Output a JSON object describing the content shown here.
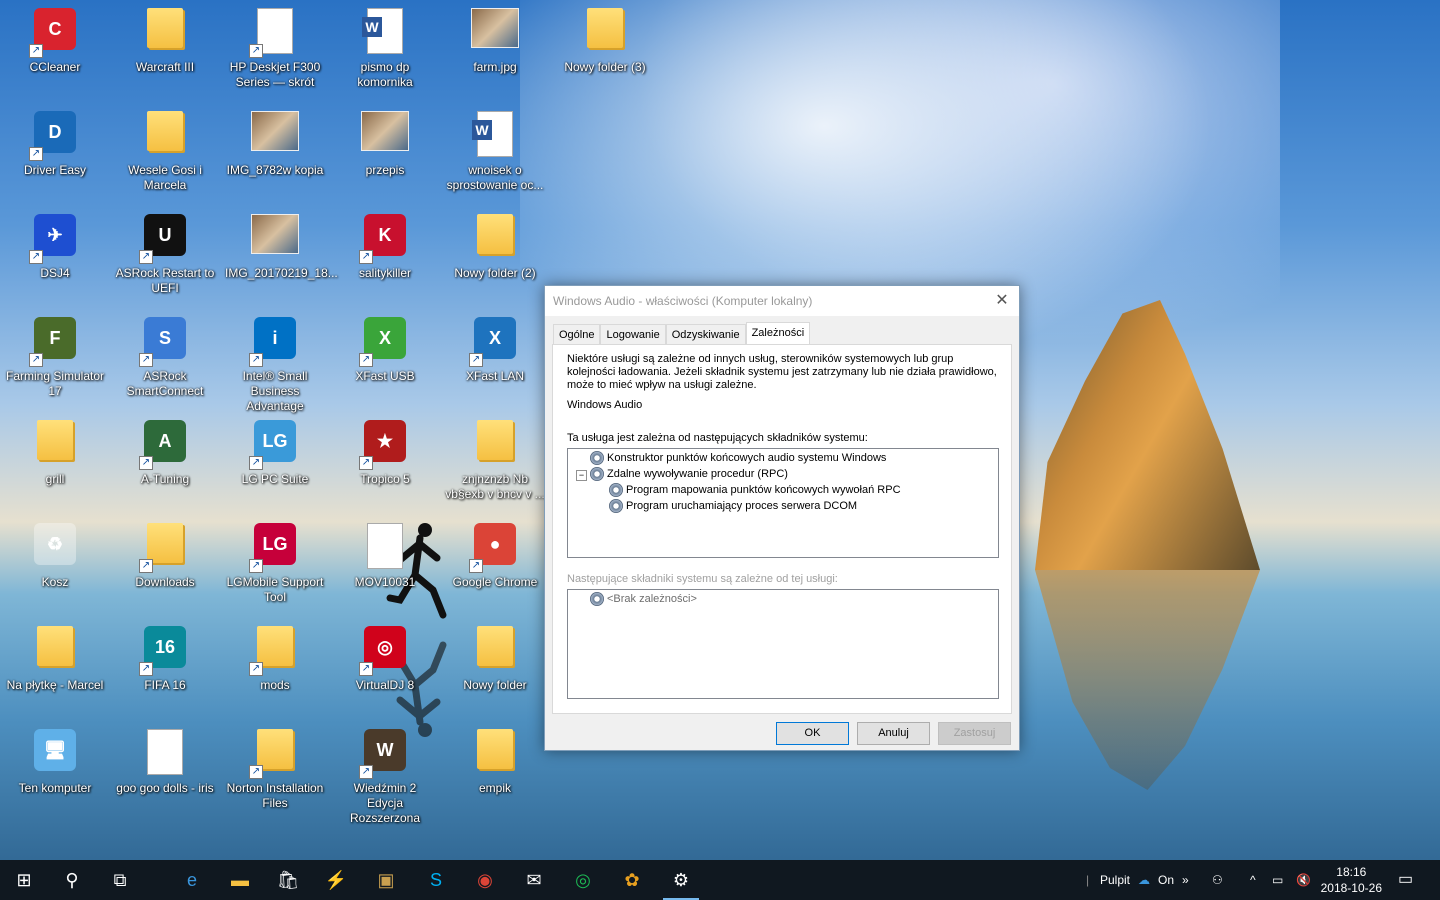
{
  "desktop": {
    "icons": [
      {
        "label": "CCleaner",
        "kind": "app",
        "color": "#d9232e",
        "glyph": "C",
        "shortcut": true
      },
      {
        "label": "Warcraft III",
        "kind": "folder",
        "shortcut": false
      },
      {
        "label": "HP Deskjet F300 Series — skrót",
        "kind": "doc",
        "shortcut": true
      },
      {
        "label": "pismo dp komornika",
        "kind": "word",
        "shortcut": false
      },
      {
        "label": "farm.jpg",
        "kind": "photo",
        "shortcut": false
      },
      {
        "label": "Nowy folder (3)",
        "kind": "folder",
        "shortcut": false
      },
      {
        "label": "Driver Easy",
        "kind": "app",
        "color": "#1a6ab8",
        "glyph": "D",
        "shortcut": true
      },
      {
        "label": "Wesele Gosi i Marcela",
        "kind": "folder",
        "shortcut": false
      },
      {
        "label": "IMG_8782w kopia",
        "kind": "photo",
        "shortcut": false
      },
      {
        "label": "przepis",
        "kind": "photo",
        "shortcut": false
      },
      {
        "label": "wnoisek o sprostowanie oc...",
        "kind": "word",
        "shortcut": false
      },
      {
        "label": "DSJ4",
        "kind": "app",
        "color": "#1e4fd1",
        "glyph": "✈",
        "shortcut": true
      },
      {
        "label": "ASRock Restart to UEFI",
        "kind": "app",
        "color": "#111111",
        "glyph": "U",
        "shortcut": true
      },
      {
        "label": "IMG_20170219_18...",
        "kind": "photo",
        "shortcut": false
      },
      {
        "label": "salitykiller",
        "kind": "app",
        "color": "#c8102e",
        "glyph": "K",
        "shortcut": true
      },
      {
        "label": "Nowy folder (2)",
        "kind": "folder",
        "shortcut": false
      },
      {
        "label": "Farming Simulator 17",
        "kind": "app",
        "color": "#4a6b2a",
        "glyph": "F",
        "shortcut": true
      },
      {
        "label": "ASRock SmartConnect",
        "kind": "app",
        "color": "#3a7bd5",
        "glyph": "S",
        "shortcut": true
      },
      {
        "label": "Intel® Small Business Advantage",
        "kind": "app",
        "color": "#0071c5",
        "glyph": "i",
        "shortcut": true
      },
      {
        "label": "XFast USB",
        "kind": "app",
        "color": "#3aa53a",
        "glyph": "X",
        "shortcut": true
      },
      {
        "label": "XFast LAN",
        "kind": "app",
        "color": "#1e73be",
        "glyph": "X",
        "shortcut": true
      },
      {
        "label": "grill",
        "kind": "folder",
        "shortcut": false
      },
      {
        "label": "A-Tuning",
        "kind": "app",
        "color": "#2d6a3a",
        "glyph": "A",
        "shortcut": true
      },
      {
        "label": "LG PC Suite",
        "kind": "app",
        "color": "#3a9ad9",
        "glyph": "LG",
        "shortcut": true
      },
      {
        "label": "Tropico 5",
        "kind": "app",
        "color": "#b01c1c",
        "glyph": "★",
        "shortcut": true
      },
      {
        "label": "znjnznzb Nb vb§exb v bncv v ...",
        "kind": "folder",
        "shortcut": false
      },
      {
        "label": "Kosz",
        "kind": "bin",
        "shortcut": false
      },
      {
        "label": "Downloads",
        "kind": "folder",
        "shortcut": true
      },
      {
        "label": "LGMobile Support Tool",
        "kind": "app",
        "color": "#c6003a",
        "glyph": "LG",
        "shortcut": true
      },
      {
        "label": "MOV10031",
        "kind": "doc",
        "shortcut": false
      },
      {
        "label": "Google Chrome",
        "kind": "app",
        "color": "#db4437",
        "glyph": "●",
        "shortcut": true
      },
      {
        "label": "Na płytkę - Marcel",
        "kind": "folder",
        "shortcut": false
      },
      {
        "label": "FIFA 16",
        "kind": "app",
        "color": "#0a8a9a",
        "glyph": "16",
        "shortcut": true
      },
      {
        "label": "mods",
        "kind": "folder",
        "shortcut": true
      },
      {
        "label": "VirtualDJ 8",
        "kind": "app",
        "color": "#d0021b",
        "glyph": "◎",
        "shortcut": true
      },
      {
        "label": "Nowy folder",
        "kind": "folder",
        "shortcut": false
      },
      {
        "label": "Ten komputer",
        "kind": "pc",
        "shortcut": false
      },
      {
        "label": "goo goo dolls - iris",
        "kind": "doc",
        "shortcut": false
      },
      {
        "label": "Norton Installation Files",
        "kind": "folder",
        "shortcut": true
      },
      {
        "label": "Wiedźmin 2 Edycja Rozszerzona",
        "kind": "app",
        "color": "#4a3a2a",
        "glyph": "W",
        "shortcut": true
      },
      {
        "label": "empik",
        "kind": "folder",
        "shortcut": false
      }
    ]
  },
  "dialog": {
    "title": "Windows Audio - właściwości (Komputer lokalny)",
    "tabs": [
      "Ogólne",
      "Logowanie",
      "Odzyskiwanie",
      "Zależności"
    ],
    "active_tab": "Zależności",
    "description": "Niektóre usługi są zależne od innych usług, sterowników systemowych lub grup kolejności ładowania. Jeżeli składnik systemu jest zatrzymany lub nie działa prawidłowo, może to mieć wpływ na usługi zależne.",
    "service_name": "Windows Audio",
    "depends_on_label": "Ta usługa jest zależna od następujących składników systemu:",
    "depends_on": [
      "Konstruktor punktów końcowych audio systemu Windows",
      "Zdalne wywoływanie procedur (RPC)",
      "Program mapowania punktów końcowych wywołań RPC",
      "Program uruchamiający proces serwera DCOM"
    ],
    "dependents_label": "Następujące składniki systemu są zależne od tej usługi:",
    "dependents": [
      "<Brak zależności>"
    ],
    "buttons": {
      "ok": "OK",
      "cancel": "Anuluj",
      "apply": "Zastosuj"
    }
  },
  "taskbar": {
    "tray_label": "Pulpit",
    "onedrive": "On",
    "time": "18:16",
    "date": "2018-10-26",
    "apps": [
      "start-icon",
      "search-icon",
      "task-view-icon",
      "edge-icon",
      "file-explorer-icon",
      "store-icon",
      "tool-icon",
      "game-icon",
      "skype-icon",
      "chrome-icon",
      "mail-icon",
      "spotify-icon",
      "picasa-icon",
      "settings-icon"
    ],
    "running": [
      "settings-icon"
    ]
  },
  "colors": {
    "accent": "#0078d7",
    "taskbar": "#101820"
  }
}
